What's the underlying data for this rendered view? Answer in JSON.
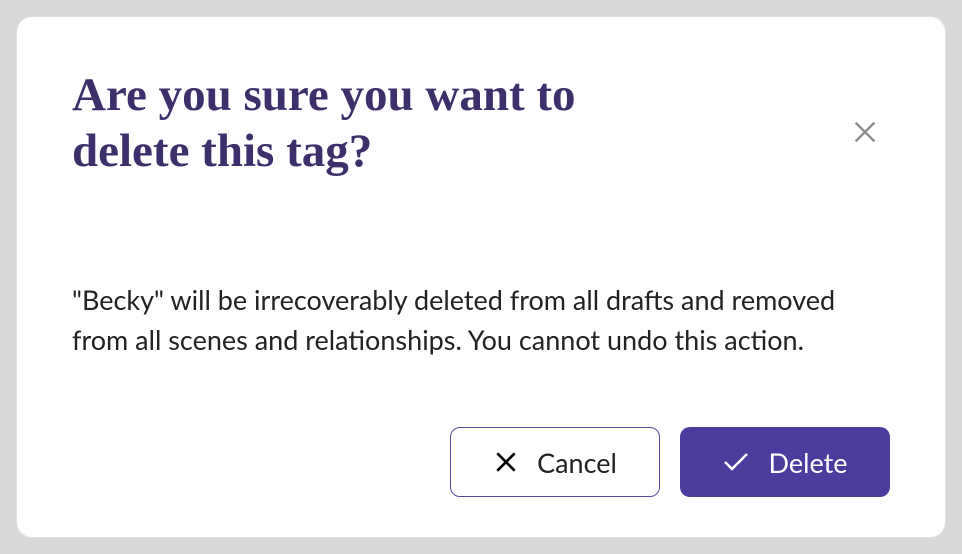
{
  "dialog": {
    "title": "Are you sure you want to delete this tag?",
    "message": "\"Becky\" will be irrecoverably deleted from all drafts and removed from all scenes and relationships. You cannot undo this action.",
    "cancel_label": "Cancel",
    "delete_label": "Delete"
  }
}
